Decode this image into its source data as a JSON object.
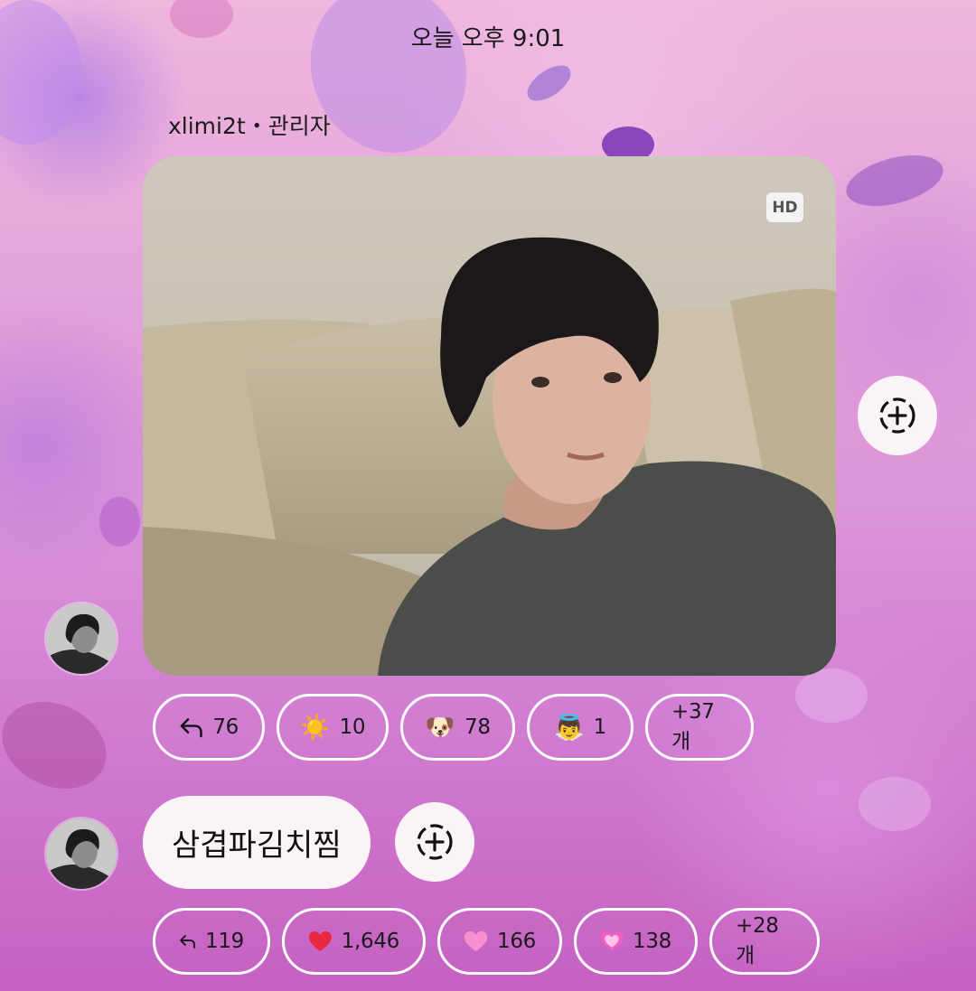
{
  "timestamp": "오늘 오후 9:01",
  "message1": {
    "sender": "xlimi2t・관리자",
    "hd_badge": "HD",
    "add_reaction_icon": "add-reaction-icon",
    "reactions": [
      {
        "icon": "reply-icon",
        "emoji": "",
        "count": "76"
      },
      {
        "icon": "sun-emoji",
        "emoji": "☀️",
        "count": "10"
      },
      {
        "icon": "dog-face-emoji",
        "emoji": "🐶",
        "count": "78"
      },
      {
        "icon": "angel-baby-emoji",
        "emoji": "👼",
        "count": "1"
      }
    ],
    "more": "+37개"
  },
  "message2": {
    "text": "삼겹파김치찜",
    "add_reaction_icon": "add-reaction-icon",
    "reactions": [
      {
        "icon": "reply-icon",
        "emoji": "",
        "count": "119"
      },
      {
        "icon": "red-heart-emoji",
        "emoji": "❤️",
        "count": "1,646"
      },
      {
        "icon": "pink-heart-emoji",
        "emoji": "🩷",
        "count": "166"
      },
      {
        "icon": "sparkling-heart-emoji",
        "emoji": "💗",
        "count": "138"
      }
    ],
    "more": "+28개"
  },
  "colors": {
    "bubble": "#fbf4f6",
    "chip_border": "#ffffff",
    "text": "#1a1a1a"
  }
}
